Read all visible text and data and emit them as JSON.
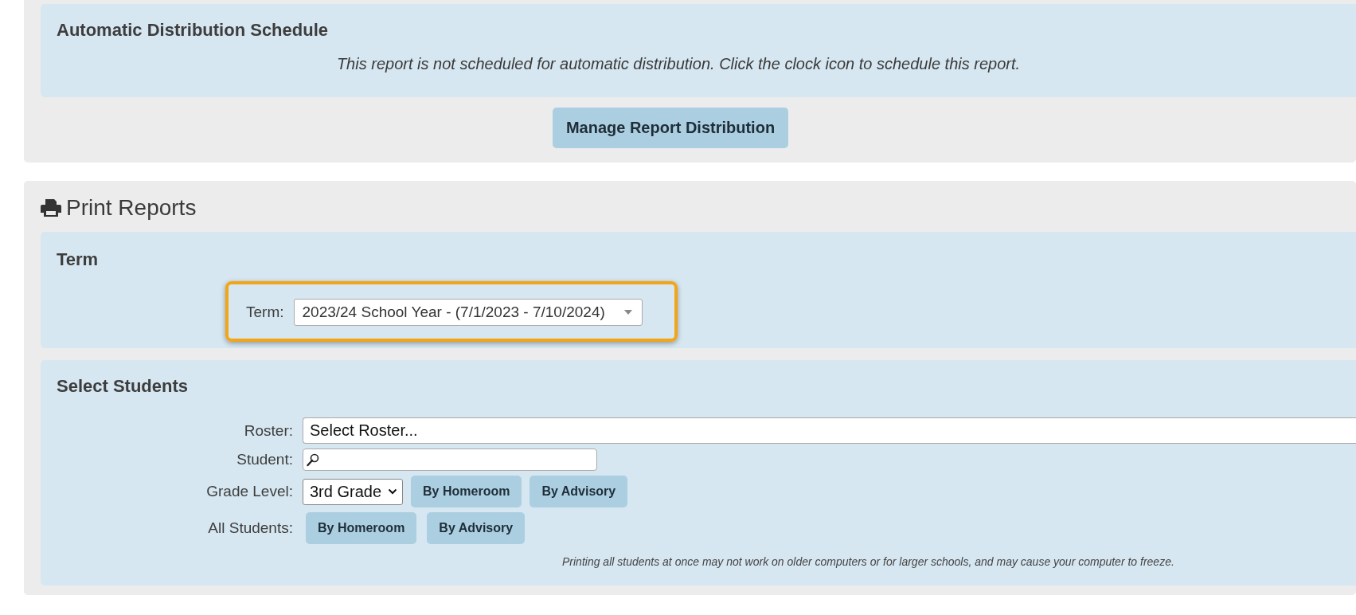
{
  "distribution": {
    "title": "Automatic Distribution Schedule",
    "message": "This report is not scheduled for automatic distribution. Click the clock icon to schedule this report.",
    "button": "Manage Report Distribution"
  },
  "print_reports": {
    "title": "Print Reports",
    "term": {
      "title": "Term",
      "label": "Term:",
      "value": "2023/24 School Year - (7/1/2023 - 7/10/2024)",
      "highlighted": true
    },
    "select_students": {
      "title": "Select Students",
      "rows": [
        {
          "kind": "select",
          "label": "Roster:",
          "value": "Select Roster..."
        },
        {
          "kind": "search",
          "label": "Student:"
        },
        {
          "kind": "grade",
          "label": "Grade Level:",
          "value": "3rd Grade",
          "buttons": [
            "By Homeroom",
            "By Advisory"
          ]
        },
        {
          "kind": "buttons",
          "label": "All Students:",
          "buttons": [
            "By Homeroom",
            "By Advisory"
          ]
        }
      ],
      "note": "Printing all students at once may not work on older computers or for larger schools, and may cause your computer to freeze."
    }
  }
}
